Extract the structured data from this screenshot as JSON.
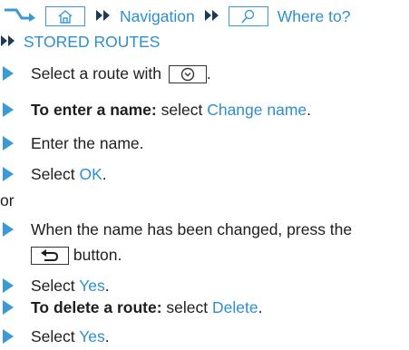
{
  "path": {
    "nav": "Navigation",
    "where_to": "Where to?",
    "stored_routes": "STORED ROUTES"
  },
  "icons": {
    "start_arrow": "right-angle-arrow-icon",
    "home": "home-icon",
    "double_arrow": "double-chevron-right-icon",
    "search": "magnifier-icon",
    "select_knob": "chevron-down-circle-icon",
    "back": "back-arrow-icon"
  },
  "colors": {
    "accent": "#2e8fcf",
    "text": "#1e1e1e"
  },
  "steps": {
    "s1_pre": "Select a route with",
    "s1_post": ".",
    "s2_bold": "To enter a name:",
    "s2_pre": " select ",
    "s2_link": "Change name",
    "s2_post": ".",
    "s3": "Enter the name.",
    "s4_pre": "Select ",
    "s4_link": "OK",
    "s4_post": ".",
    "or": "or",
    "s5_pre": "When the name has been changed, press the",
    "s5_post": " button.",
    "s6_pre": "Select ",
    "s6_link": "Yes",
    "s6_post": ".",
    "s7_bold": "To delete a route:",
    "s7_pre": " select ",
    "s7_link": "Delete",
    "s7_post": ".",
    "s8_pre": "Select ",
    "s8_link": "Yes",
    "s8_post": "."
  }
}
